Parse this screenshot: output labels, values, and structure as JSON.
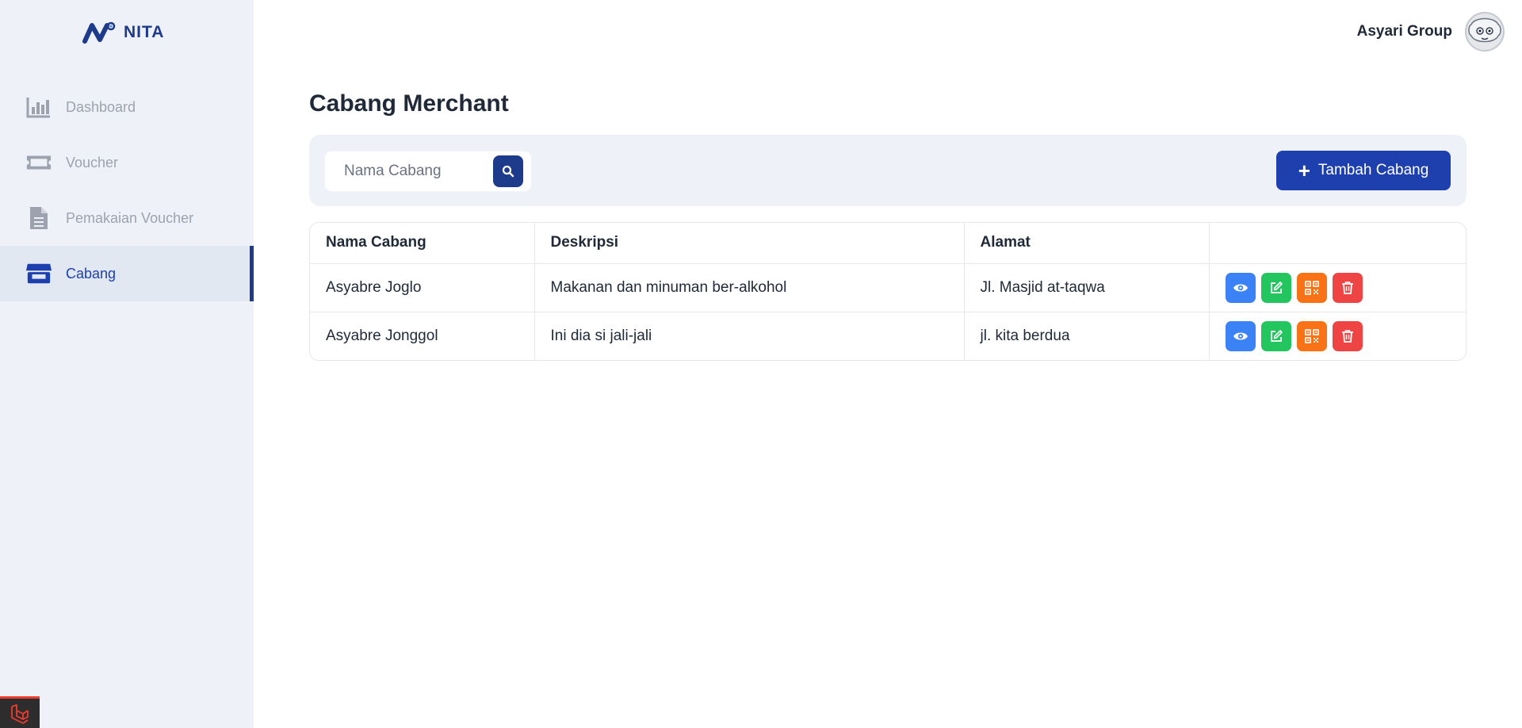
{
  "brand": {
    "name": "NITA",
    "color": "#1e3a8a"
  },
  "user": {
    "name": "Asyari Group",
    "avatar_icon": "avatar-icon"
  },
  "sidebar": {
    "items": [
      {
        "label": "Dashboard",
        "icon": "bar-chart-icon",
        "active": false
      },
      {
        "label": "Voucher",
        "icon": "ticket-icon",
        "active": false
      },
      {
        "label": "Pemakaian Voucher",
        "icon": "document-icon",
        "active": false
      },
      {
        "label": "Cabang",
        "icon": "store-icon",
        "active": true
      }
    ]
  },
  "page": {
    "title": "Cabang Merchant"
  },
  "search": {
    "placeholder": "Nama Cabang",
    "value": ""
  },
  "add_button": {
    "label": "Tambah Cabang"
  },
  "table": {
    "headers": [
      "Nama Cabang",
      "Deskripsi",
      "Alamat",
      ""
    ],
    "rows": [
      {
        "name": "Asyabre Joglo",
        "description": "Makanan dan minuman ber-alkohol",
        "address": "Jl. Masjid at-taqwa"
      },
      {
        "name": "Asyabre Jonggol",
        "description": "Ini dia si jali-jali",
        "address": "jl. kita berdua"
      }
    ]
  },
  "action_colors": {
    "view": "#3b82f6",
    "edit": "#22c55e",
    "qr": "#f97316",
    "delete": "#ef4444"
  }
}
